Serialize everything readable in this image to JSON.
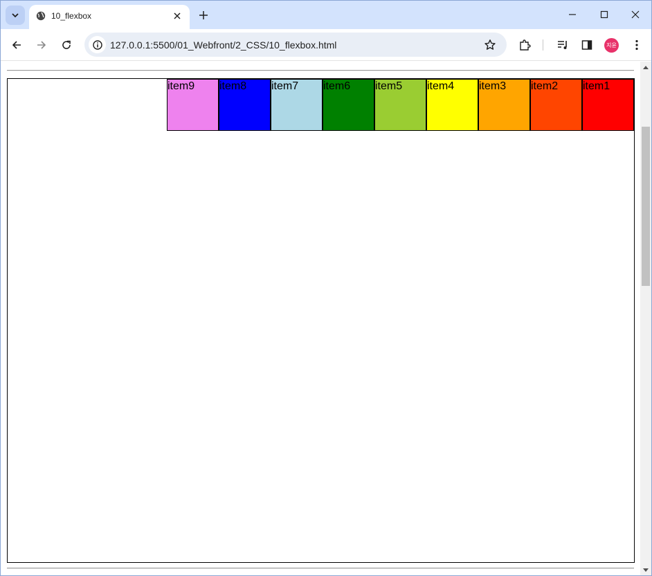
{
  "browser": {
    "tab_title": "10_flexbox",
    "url": "127.0.0.1:5500/01_Webfront/2_CSS/10_flexbox.html",
    "avatar_text": "지윤",
    "accent_color": "#d3e3fd"
  },
  "page": {
    "items": [
      {
        "label": "item1",
        "color": "#ff0000"
      },
      {
        "label": "item2",
        "color": "#ff4500"
      },
      {
        "label": "item3",
        "color": "#ffa500"
      },
      {
        "label": "item4",
        "color": "#ffff00"
      },
      {
        "label": "item5",
        "color": "#9acd32"
      },
      {
        "label": "item6",
        "color": "#008000"
      },
      {
        "label": "item7",
        "color": "#add8e6"
      },
      {
        "label": "item8",
        "color": "#0000ff"
      },
      {
        "label": "item9",
        "color": "#ee82ee"
      }
    ]
  }
}
